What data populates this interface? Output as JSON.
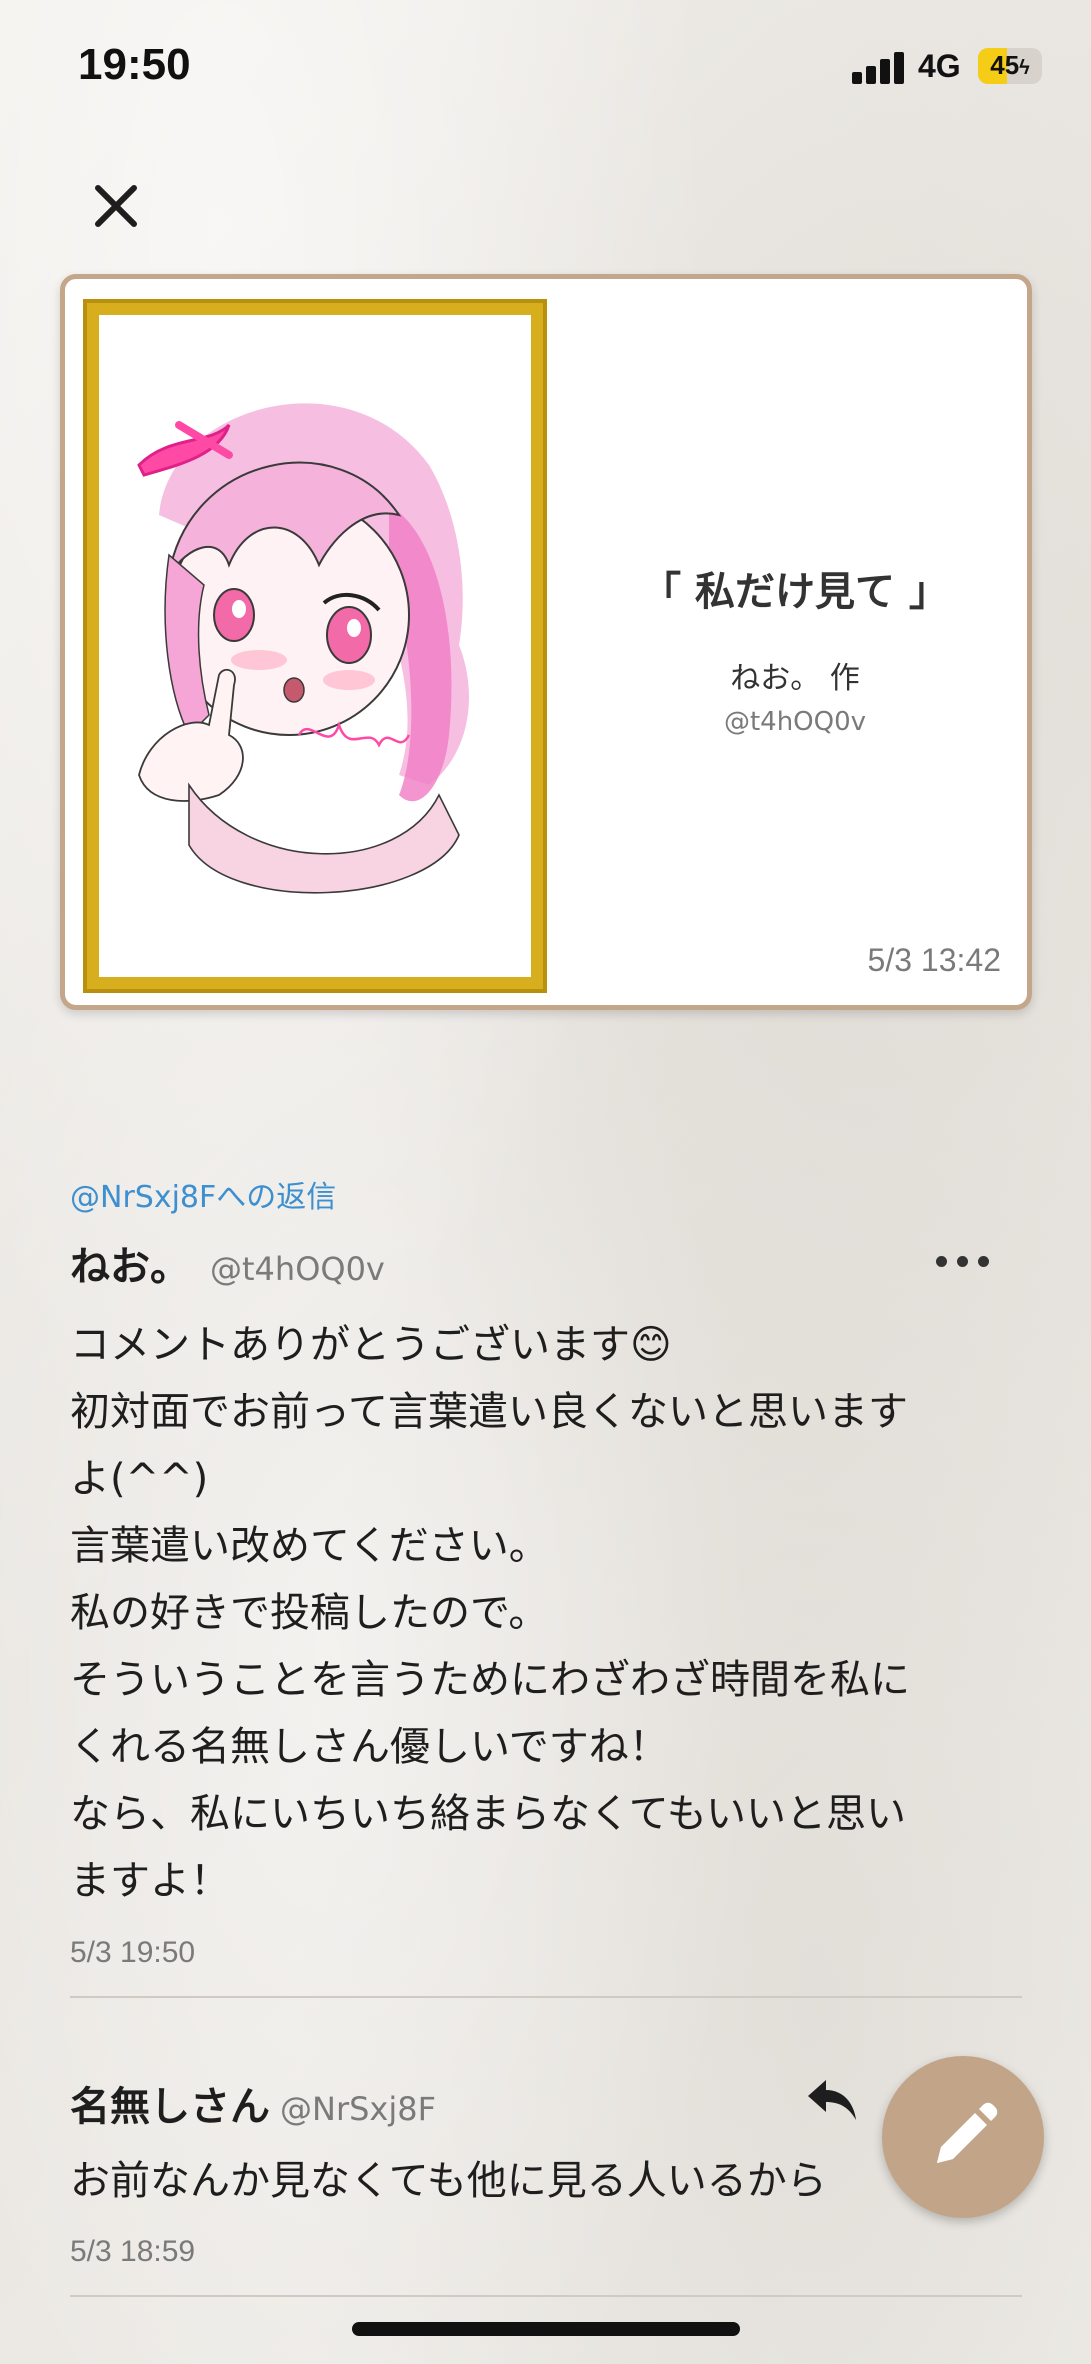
{
  "status_bar": {
    "time": "19:50",
    "network": "4G",
    "battery": "45",
    "battery_level_percent": 45,
    "charging": true
  },
  "header": {
    "close_icon": "close-icon"
  },
  "artwork": {
    "title": "「 私だけ見て 」",
    "author": "ねお。 作",
    "handle": "@t4hOQ0v",
    "date": "5/3 13:42",
    "frame_color": "#d7ae1e",
    "card_border_color": "#c4a78a"
  },
  "comments": [
    {
      "reply_to": "@NrSxj8Fへの返信",
      "name": "ねお。",
      "handle": "@t4hOQ0v",
      "lines": [
        "コメントありがとうございます😊",
        "初対面でお前って言葉遣い良くないと思います",
        "よ(^^)",
        "言葉遣い改めてください。",
        "私の好きで投稿したので。",
        "そういうことを言うためにわざわざ時間を私に",
        "くれる名無しさん優しいですね！",
        "なら、私にいちいち絡まらなくてもいいと思い",
        "ますよ！"
      ],
      "time": "5/3 19:50",
      "more_icon": "more-icon"
    },
    {
      "name": "名無しさん",
      "handle": "@NrSxj8F",
      "text": "お前なんか見なくても他に見る人いるから",
      "time": "5/3 18:59",
      "reply_icon": "reply-icon"
    }
  ],
  "fab": {
    "icon": "pencil-icon",
    "color": "#c2a588"
  },
  "colors": {
    "accent_link": "#3d8fd0",
    "muted_text": "#7a7a7a"
  }
}
